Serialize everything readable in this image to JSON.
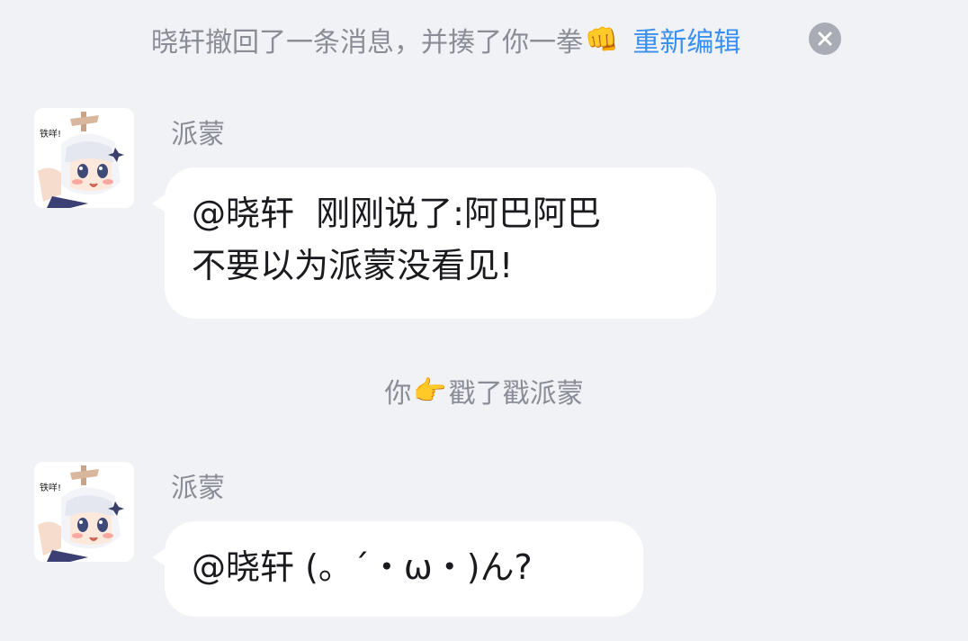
{
  "system_notice": {
    "text": "晓轩撤回了一条消息，并揍了你一拳",
    "emoji": "👊",
    "reedit_label": "重新编辑",
    "close_icon": "close-circle-icon"
  },
  "messages": [
    {
      "sender": "派蒙",
      "avatar_text": "铁咩!",
      "lines": [
        "@晓轩  刚刚说了:阿巴阿巴",
        "不要以为派蒙没看见!"
      ]
    },
    {
      "sender": "派蒙",
      "avatar_text": "铁咩!",
      "lines": [
        "@晓轩 (。´・ω・)ん?"
      ]
    }
  ],
  "poke_notice": {
    "subject": "你",
    "emoji": "👉",
    "action": "戳了戳派蒙"
  },
  "colors": {
    "background": "#f1f2f6",
    "bubble": "#ffffff",
    "meta_text": "#8a8d96",
    "link": "#3b8ff0"
  }
}
